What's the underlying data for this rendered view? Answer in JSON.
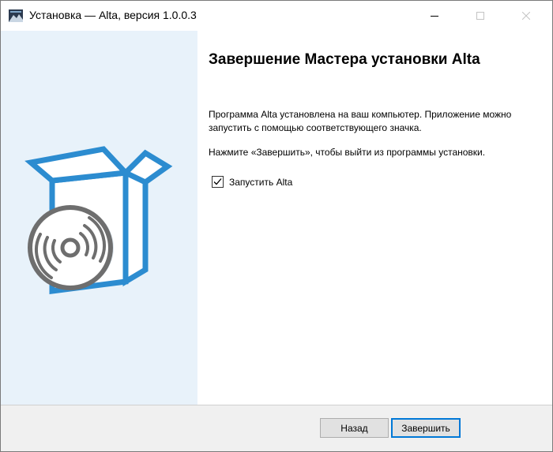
{
  "window": {
    "title": "Установка — Alta, версия 1.0.0.3",
    "app_icon": "installer-app-icon",
    "controls": [
      "minimize-icon",
      "maximize-icon",
      "close-icon"
    ]
  },
  "illustration": {
    "icon": "box-with-disc-icon"
  },
  "main": {
    "heading": "Завершение Мастера установки Alta",
    "paragraph1": "Программа Alta установлена на ваш компьютер. Приложение можно запустить с помощью соответствующего значка.",
    "paragraph2": "Нажмите «Завершить», чтобы выйти из программы установки.",
    "launch_checkbox": {
      "label": "Запустить Alta",
      "checked": true
    }
  },
  "footer": {
    "back_label": "Назад",
    "finish_label": "Завершить"
  },
  "colors": {
    "accent": "#2c8cd0",
    "sidebar_bg": "#e8f2fa",
    "disc": "#6e6e6e",
    "focus_border": "#0078d7"
  }
}
